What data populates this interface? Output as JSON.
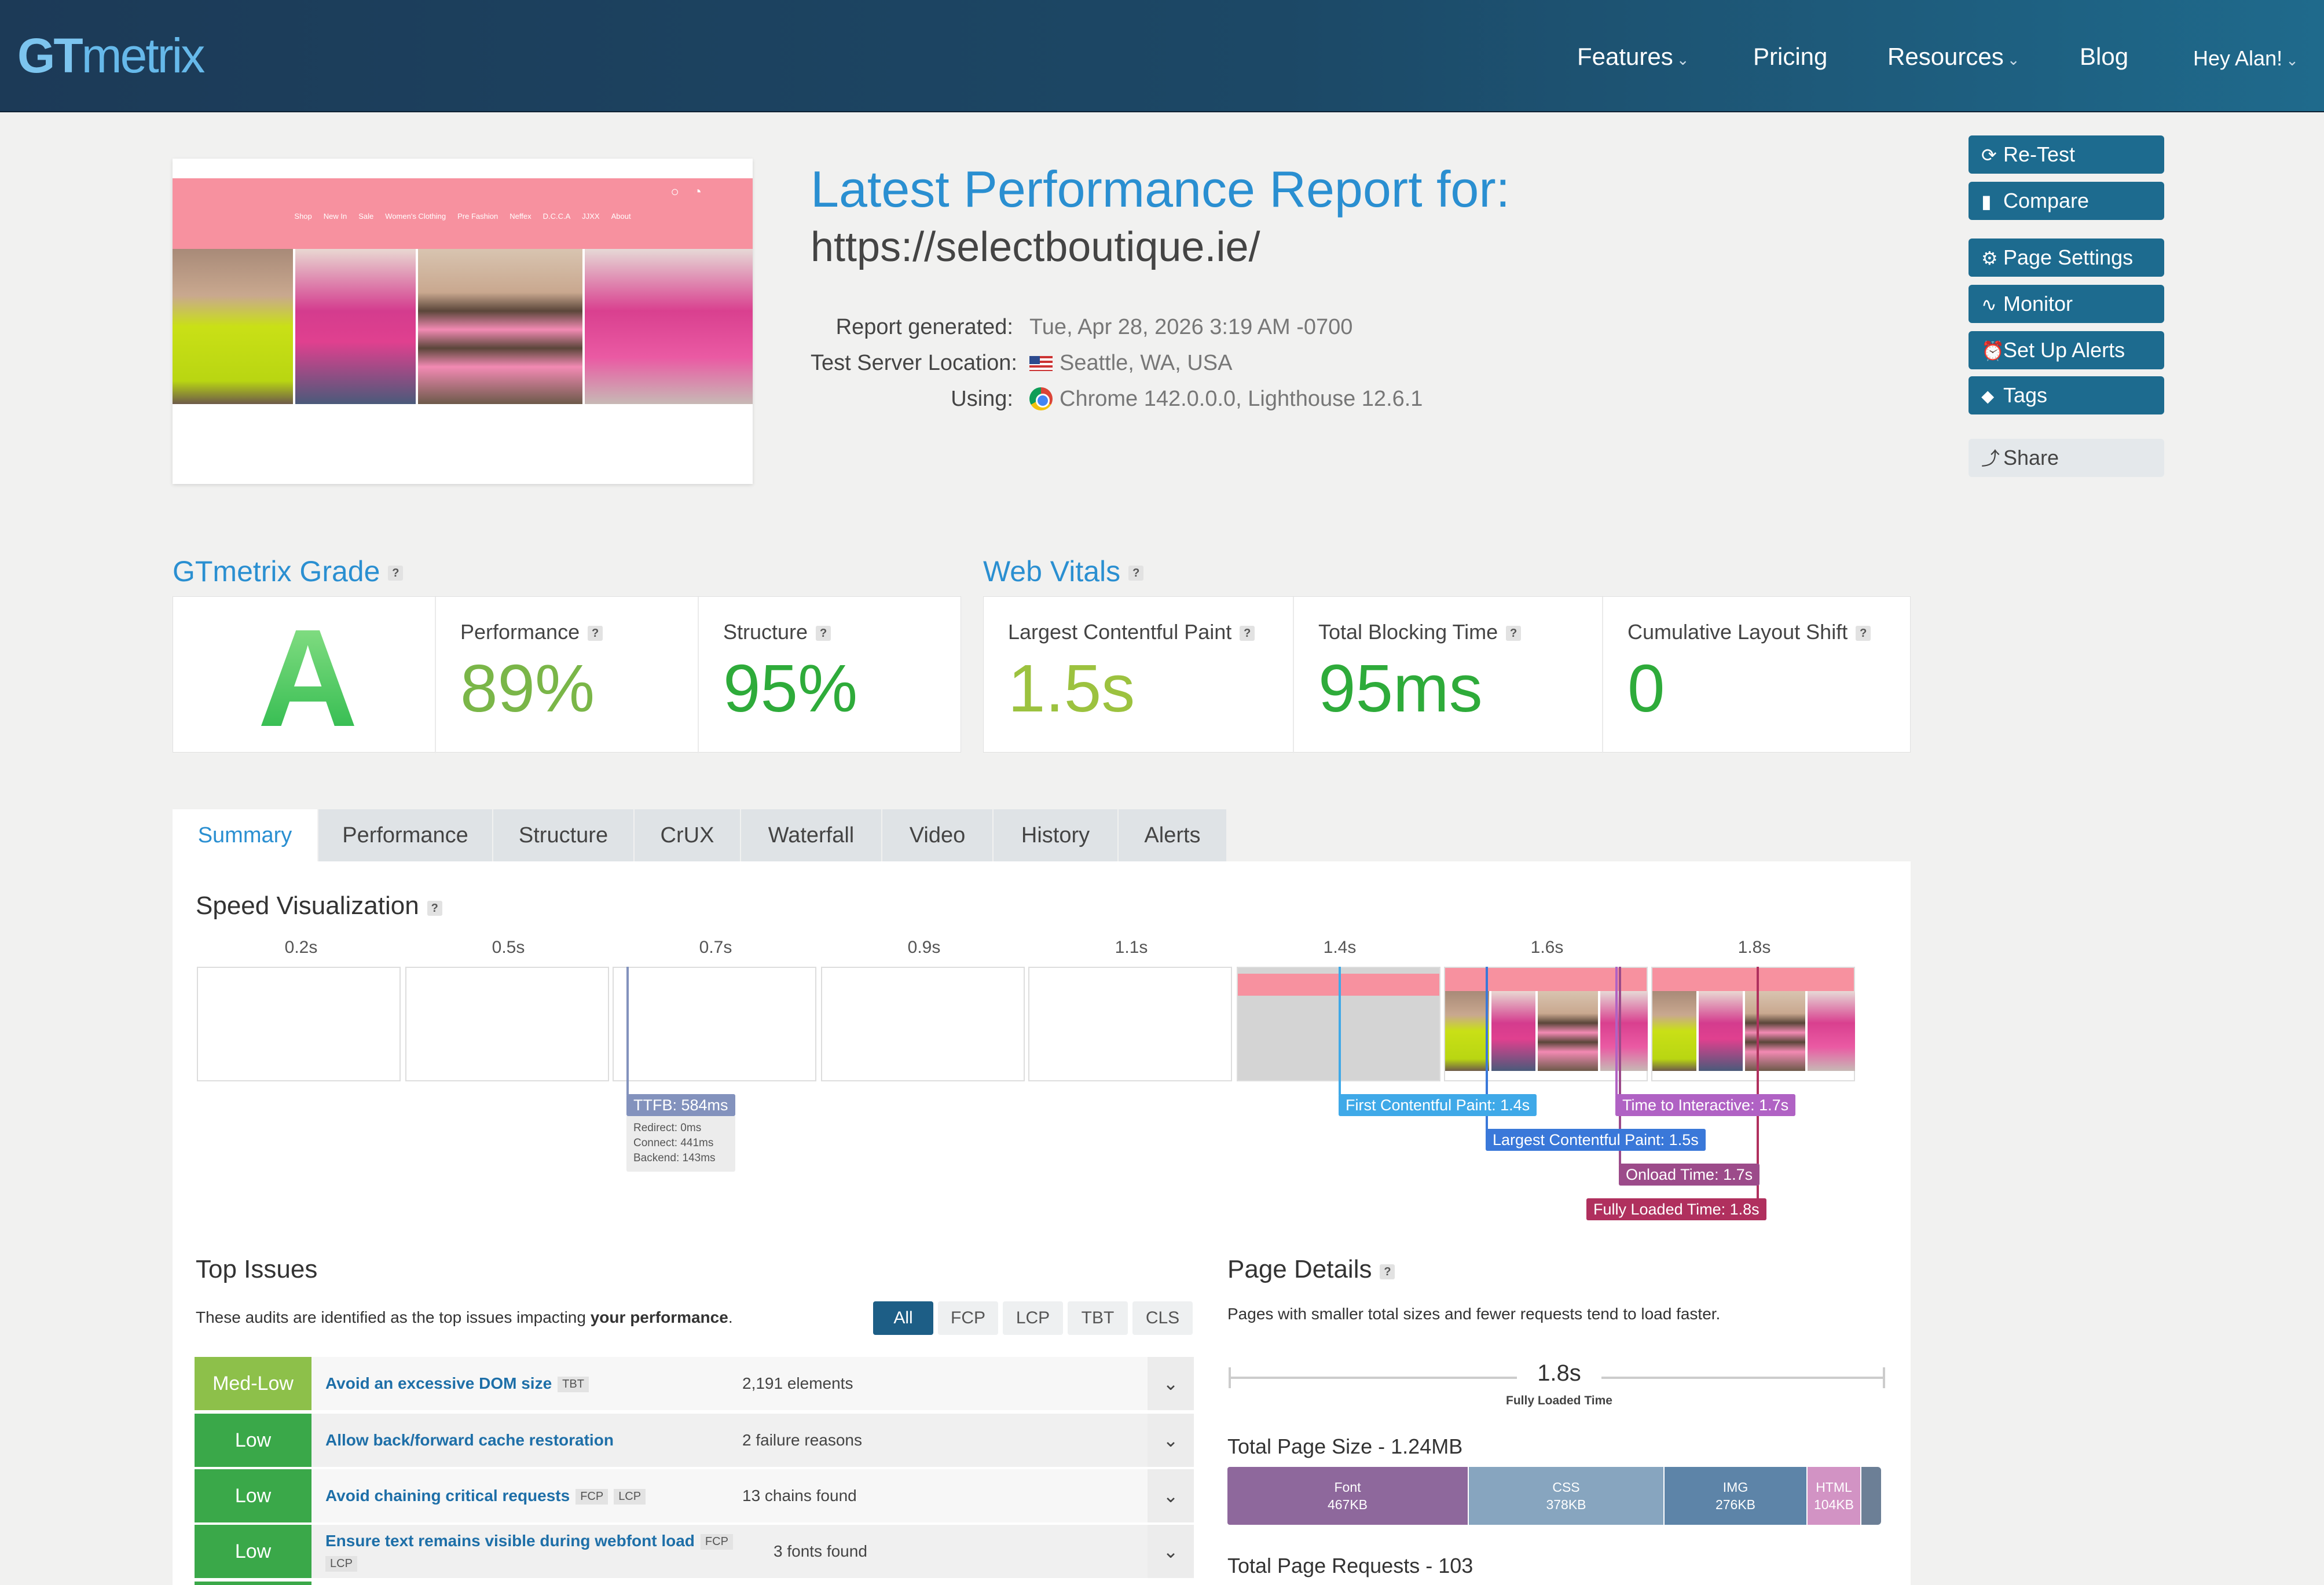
{
  "header": {
    "logo_prefix": "GT",
    "logo_suffix": "metrix",
    "nav": [
      {
        "label": "Features",
        "dropdown": true
      },
      {
        "label": "Pricing",
        "dropdown": false
      },
      {
        "label": "Resources",
        "dropdown": true
      },
      {
        "label": "Blog",
        "dropdown": false
      }
    ],
    "user_greeting": "Hey Alan!",
    "colors": {
      "bg_start": "#1c3a57",
      "bg_end": "#1f6a8c",
      "logo": "#7cc4ee"
    }
  },
  "thumbnail": {
    "menu": [
      "Shop",
      "New In",
      "Sale",
      "Women's Clothing",
      "Pre Fashion",
      "Neffex",
      "D.C.C.A",
      "JJXX",
      "About"
    ],
    "icons": [
      "search-icon",
      "cart-icon"
    ]
  },
  "report": {
    "title": "Latest Performance Report for:",
    "url": "https://selectboutique.ie/",
    "meta": [
      {
        "label": "Report generated:",
        "value": "Tue, Apr 28, 2026 3:19 AM -0700",
        "icon": ""
      },
      {
        "label": "Test Server Location:",
        "value": "Seattle, WA, USA",
        "icon": "us-flag-icon"
      },
      {
        "label": "Using:",
        "value": "Chrome 142.0.0.0, Lighthouse 12.6.1",
        "icon": "chrome-icon"
      }
    ]
  },
  "actions": [
    {
      "label": "Re-Test",
      "icon": "refresh-icon",
      "glyph": "⟳"
    },
    {
      "label": "Compare",
      "icon": "compare-icon",
      "glyph": "▮"
    },
    {
      "label": "Page Settings",
      "icon": "gear-icon",
      "glyph": "⚙"
    },
    {
      "label": "Monitor",
      "icon": "pulse-icon",
      "glyph": "∿"
    },
    {
      "label": "Set Up Alerts",
      "icon": "alarm-icon",
      "glyph": "⏰"
    },
    {
      "label": "Tags",
      "icon": "tag-icon",
      "glyph": "⬥"
    },
    {
      "label": "Share",
      "icon": "share-icon",
      "glyph": "⤴"
    }
  ],
  "grade": {
    "section_title": "GTmetrix Grade",
    "letter": "A",
    "performance_label": "Performance",
    "performance_value": "89%",
    "structure_label": "Structure",
    "structure_value": "95%",
    "colors": {
      "performance": "#7ab648",
      "structure": "#2eab3a"
    }
  },
  "vitals": {
    "section_title": "Web Vitals",
    "lcp_label": "Largest Contentful Paint",
    "lcp_value": "1.5s",
    "tbt_label": "Total Blocking Time",
    "tbt_value": "95ms",
    "cls_label": "Cumulative Layout Shift",
    "cls_value": "0",
    "colors": {
      "lcp": "#9cc23f",
      "tbt": "#2eab3a",
      "cls": "#2eab3a"
    }
  },
  "tabs": [
    "Summary",
    "Performance",
    "Structure",
    "CrUX",
    "Waterfall",
    "Video",
    "History",
    "Alerts"
  ],
  "active_tab": "Summary",
  "speed_viz": {
    "title": "Speed Visualization",
    "ticks": [
      "0.2s",
      "0.5s",
      "0.7s",
      "0.9s",
      "1.1s",
      "1.4s",
      "1.6s",
      "1.8s"
    ],
    "ttfb": {
      "label": "TTFB: 584ms",
      "redirect": "Redirect: 0ms",
      "connect": "Connect: 441ms",
      "backend": "Backend: 143ms"
    },
    "markers": [
      {
        "label": "First Contentful Paint: 1.4s",
        "color": "#3fa9e8"
      },
      {
        "label": "Largest Contentful Paint: 1.5s",
        "color": "#3a78d9"
      },
      {
        "label": "Time to Interactive: 1.7s",
        "color": "#b062c4"
      },
      {
        "label": "Onload Time: 1.7s",
        "color": "#9c4b8a"
      },
      {
        "label": "Fully Loaded Time: 1.8s",
        "color": "#b0305e"
      }
    ],
    "ttfb_color": "#8392bd"
  },
  "top_issues": {
    "title": "Top Issues",
    "desc_prefix": "These audits are identified as the top issues impacting",
    "desc_bold": "your performance",
    "desc_suffix": ".",
    "filters": [
      "All",
      "FCP",
      "LCP",
      "TBT",
      "CLS"
    ],
    "active_filter": "All",
    "items": [
      {
        "severity": "Med-Low",
        "title": "Avoid an excessive DOM size",
        "badges": [
          "TBT"
        ],
        "value": "2,191 elements",
        "color": "#8dc04a"
      },
      {
        "severity": "Low",
        "title": "Allow back/forward cache restoration",
        "badges": [],
        "value": "2 failure reasons",
        "color": "#3aa849"
      },
      {
        "severity": "Low",
        "title": "Avoid chaining critical requests",
        "badges": [
          "FCP",
          "LCP"
        ],
        "value": "13 chains found",
        "color": "#3aa849"
      },
      {
        "severity": "Low",
        "title": "Ensure text remains visible during webfont load",
        "badges": [
          "FCP",
          "LCP"
        ],
        "value": "3 fonts found",
        "color": "#3aa849"
      }
    ]
  },
  "page_details": {
    "title": "Page Details",
    "desc": "Pages with smaller total sizes and fewer requests tend to load faster.",
    "fully_loaded_value": "1.8s",
    "fully_loaded_label": "Fully Loaded Time",
    "total_size_label": "Total Page Size - 1.24MB",
    "size_breakdown": [
      {
        "name": "Font",
        "size": "467KB",
        "kb": 467,
        "color": "#8e689c"
      },
      {
        "name": "CSS",
        "size": "378KB",
        "kb": 378,
        "color": "#87a5bf"
      },
      {
        "name": "IMG",
        "size": "276KB",
        "kb": 276,
        "color": "#5d84a8"
      },
      {
        "name": "HTML",
        "size": "104KB",
        "kb": 104,
        "color": "#d293c4"
      },
      {
        "name": "",
        "size": "",
        "kb": 40,
        "color": "#6c7f96"
      }
    ],
    "total_requests_label": "Total Page Requests - 103"
  }
}
